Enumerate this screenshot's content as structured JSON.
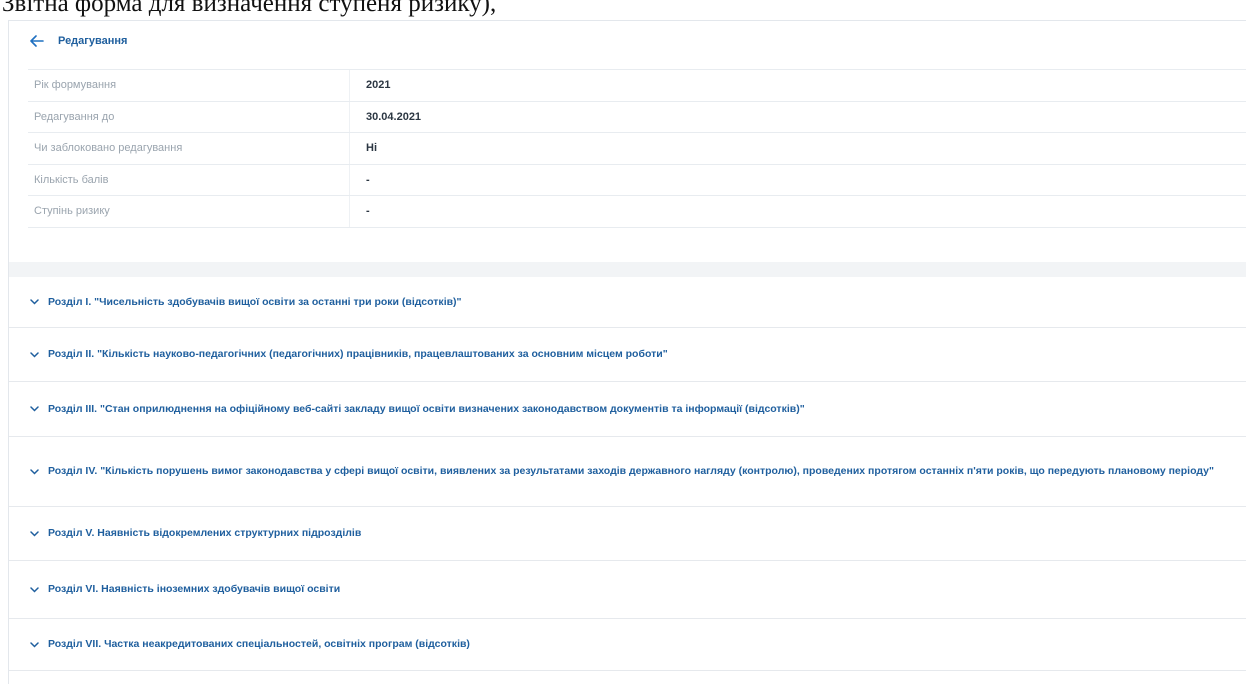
{
  "top_text": "Звітна форма для визначення ступеня ризику),",
  "header": {
    "title": "Редагування",
    "back_icon": "arrow-left-icon"
  },
  "info_rows": [
    {
      "label": "Рік формування",
      "value": "2021"
    },
    {
      "label": "Редагування до",
      "value": "30.04.2021"
    },
    {
      "label": "Чи заблоковано редагування",
      "value": "Ні"
    },
    {
      "label": "Кількість балів",
      "value": "-"
    },
    {
      "label": "Ступінь ризику",
      "value": "-"
    }
  ],
  "sections": [
    {
      "title": "Розділ І. \"Чисельність здобувачів вищої освіти за останні три роки (відсотків)\""
    },
    {
      "title": "Розділ ІІ. \"Кількість науково-педагогічних (педагогічних) працівників, працевлаштованих за основним місцем роботи\""
    },
    {
      "title": "Розділ ІІІ. \"Стан оприлюднення на офіційному веб-сайті закладу вищої освіти визначених законодавством документів та інформації (відсотків)\""
    },
    {
      "title": "Розділ IV. \"Кількість порушень вимог законодавства у сфері вищої освіти, виявлених за результатами заходів державного нагляду (контролю), проведених протягом останніх п'яти років, що передують плановому періоду\""
    },
    {
      "title": "Розділ V. Наявність відокремлених структурних підрозділів"
    },
    {
      "title": "Розділ VI. Наявність іноземних здобувачів вищої освіти"
    },
    {
      "title": "Розділ VII. Частка неакредитованих спеціальностей, освітніх програм (відсотків)"
    }
  ],
  "colors": {
    "accent": "#1f5f9e",
    "label": "#9aa4ae",
    "border": "#e6e9ed"
  }
}
